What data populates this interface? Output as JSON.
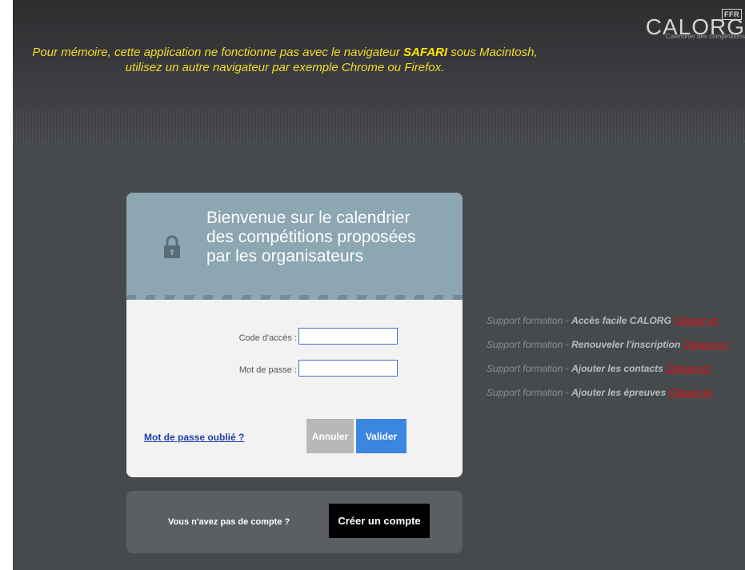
{
  "header": {
    "notice_prefix": "Pour mémoire, cette application ne fonctionne pas avec le navigateur ",
    "notice_browser": "SAFARI",
    "notice_suffix": " sous Macintosh,",
    "notice_line2": "utilisez un autre navigateur par exemple Chrome ou Firefox.",
    "logo_badge": "FFR",
    "logo_name": "CALORG",
    "logo_subtitle": "Calendrier des compétitions"
  },
  "login": {
    "welcome_line1": "Bienvenue sur le calendrier",
    "welcome_line2": "des compétitions proposées",
    "welcome_line3": "par les organisateurs",
    "lock_icon": "lock-icon",
    "access_code_label": "Code d'accès :",
    "access_code_value": "",
    "password_label": "Mot de passe :",
    "password_value": "",
    "forgot_link": "Mot de passe oublié ?",
    "cancel_label": "Annuler",
    "submit_label": "Valider"
  },
  "signup": {
    "text": "Vous n'avez pas de compte ?",
    "button_label": "Créer un compte"
  },
  "support": {
    "items": [
      {
        "prefix": "Support formation - ",
        "title": "Accès facile CALORG",
        "link": "Cliquez-ici"
      },
      {
        "prefix": "Support formation - ",
        "title": "Renouveler l'inscription",
        "link": "Cliquez-ici"
      },
      {
        "prefix": "Support formation - ",
        "title": "Ajouter les contacts",
        "link": "Cliquez-ici"
      },
      {
        "prefix": "Support formation - ",
        "title": "Ajouter les épreuves",
        "link": "Cliquez-ici"
      }
    ]
  },
  "colors": {
    "notice_yellow": "#f2dc2a",
    "header_panel": "#8ca6b2",
    "submit_blue": "#3a86e0",
    "link_red": "#e01010"
  }
}
